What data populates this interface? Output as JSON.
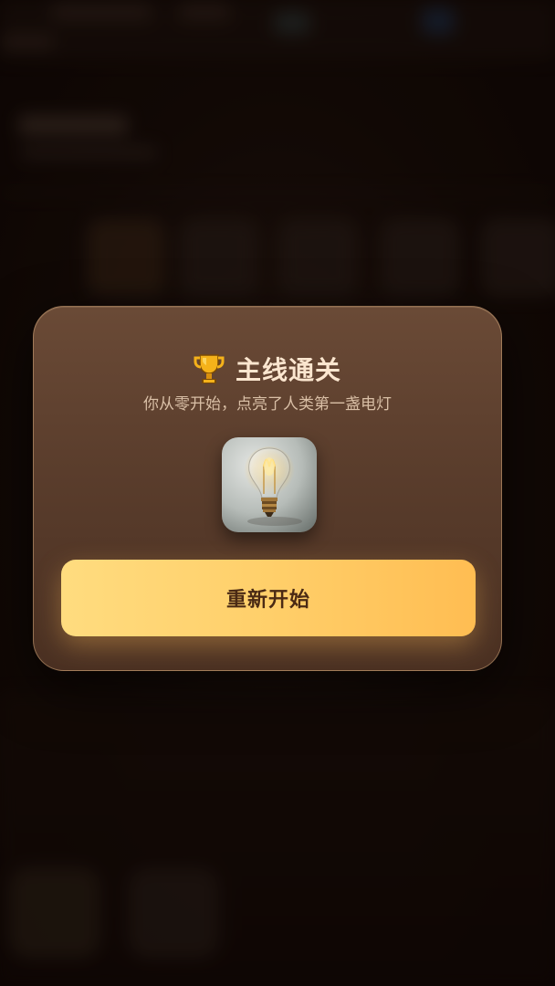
{
  "dialog": {
    "title": "主线通关",
    "subtitle": "你从零开始，点亮了人类第一盏电灯",
    "reward_icon": "light-bulb-icon",
    "trophy_icon": "trophy-icon",
    "restart_label": "重新开始"
  },
  "colors": {
    "modal_top": "#6a4a36",
    "modal_bottom": "#4a3022",
    "title": "#fbe6cf",
    "subtitle": "#d9bfa6",
    "button_start": "#ffdc7f",
    "button_end": "#ffbd52",
    "button_text": "#4a2a14"
  }
}
